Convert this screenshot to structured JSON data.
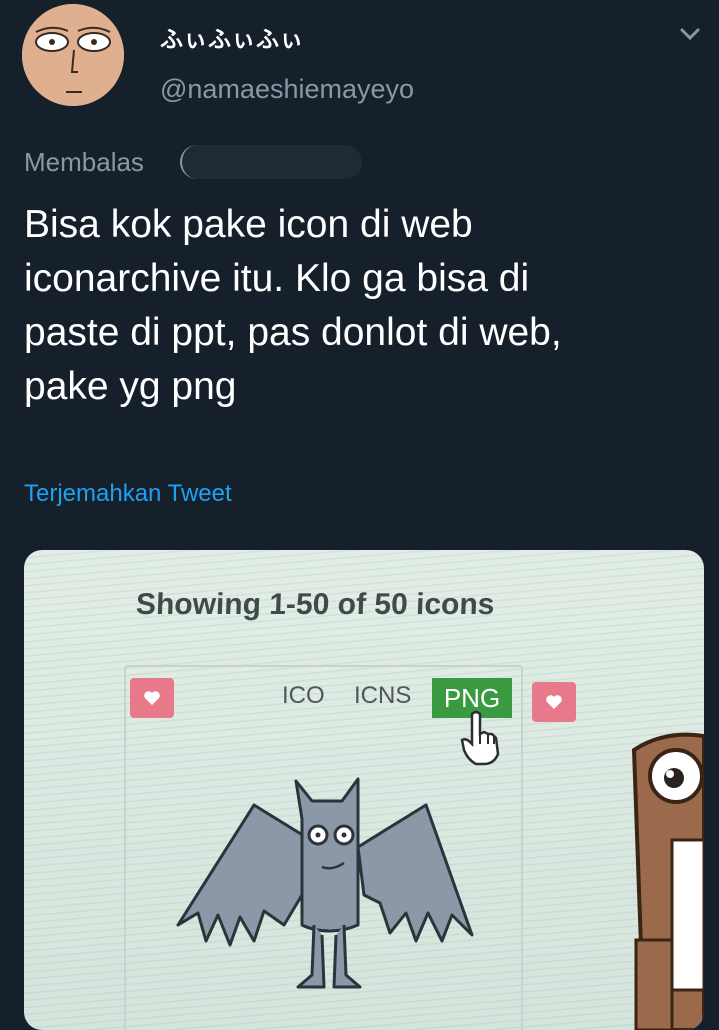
{
  "tweet": {
    "display_name": "ふぃふぃふぃ",
    "handle": "@namaeshiemayeyo",
    "replying_label": "Membalas",
    "text": "Bisa kok pake icon di web\niconarchive itu. Klo ga bisa di\npaste di ppt, pas donlot di web,\npake yg png",
    "translate_label": "Terjemahkan Tweet"
  },
  "media": {
    "showing_text": "Showing 1-50 of 50 icons",
    "formats": [
      "ICO",
      "ICNS",
      "PNG"
    ]
  },
  "colors": {
    "background": "#15202b",
    "secondary_text": "#8899a6",
    "link": "#1da1f2",
    "png_button": "#3a9a42",
    "heart_button": "#e8798a"
  },
  "icons": [
    "avatar",
    "chevron-down-icon",
    "heart-icon",
    "hand-cursor-icon",
    "bat-icon",
    "character-icon"
  ]
}
